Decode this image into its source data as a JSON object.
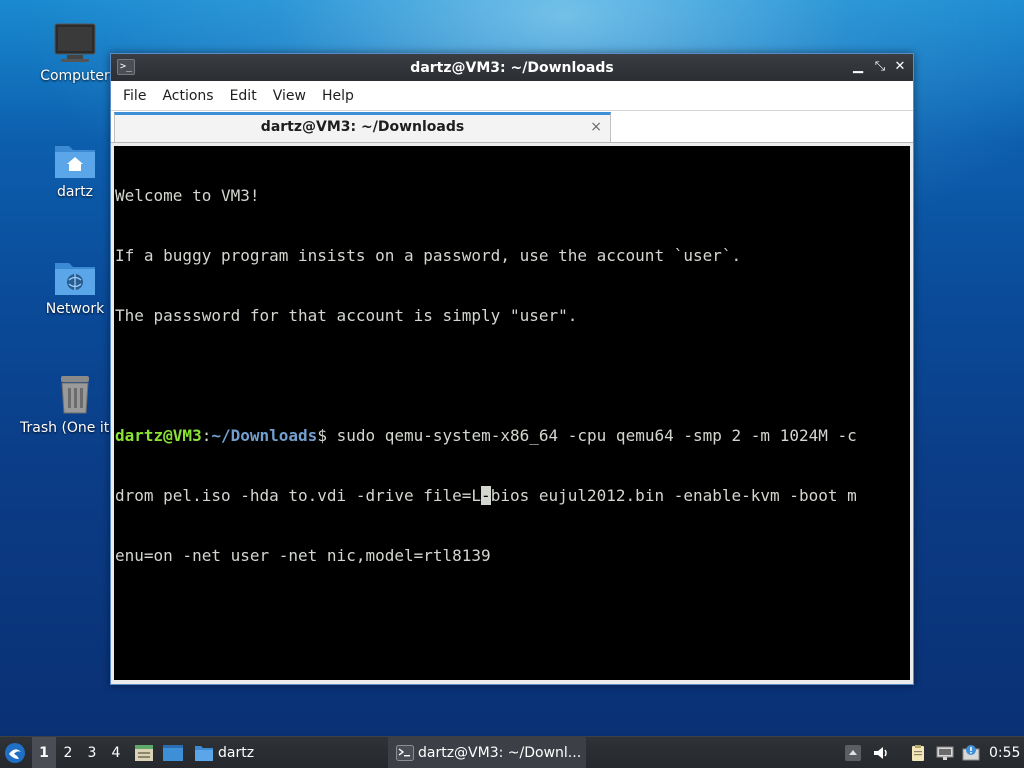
{
  "desktop": {
    "icons": [
      {
        "label": "Computer"
      },
      {
        "label": "dartz"
      },
      {
        "label": "Network"
      },
      {
        "label": "Trash (One ite"
      }
    ]
  },
  "window": {
    "title": "dartz@VM3: ~/Downloads",
    "menu": [
      "File",
      "Actions",
      "Edit",
      "View",
      "Help"
    ],
    "tab": {
      "label": "dartz@VM3: ~/Downloads",
      "close": "×"
    },
    "terminal": {
      "welcome": [
        "Welcome to VM3!",
        "If a buggy program insists on a password, use the account `user`.",
        "The passsword for that account is simply \"user\"."
      ],
      "prompt_user": "dartz@VM3",
      "prompt_sep": ":",
      "prompt_path": "~/Downloads",
      "prompt_end": "$ ",
      "cmd_line1": "sudo qemu-system-x86_64 -cpu qemu64 -smp 2 -m 1024M -c",
      "cmd_line2_before": "drom pel.iso -hda to.vdi -drive file=L",
      "cmd_cursor": "-",
      "cmd_line2_after": "bios eujul2012.bin -enable-kvm -boot m",
      "cmd_line3": "enu=on -net user -net nic,model=rtl8139"
    }
  },
  "taskbar": {
    "workspaces": [
      "1",
      "2",
      "3",
      "4"
    ],
    "active_workspace": "1",
    "folder_label": "dartz",
    "task_label": "dartz@VM3: ~/Downl...",
    "clock": "0:55"
  }
}
